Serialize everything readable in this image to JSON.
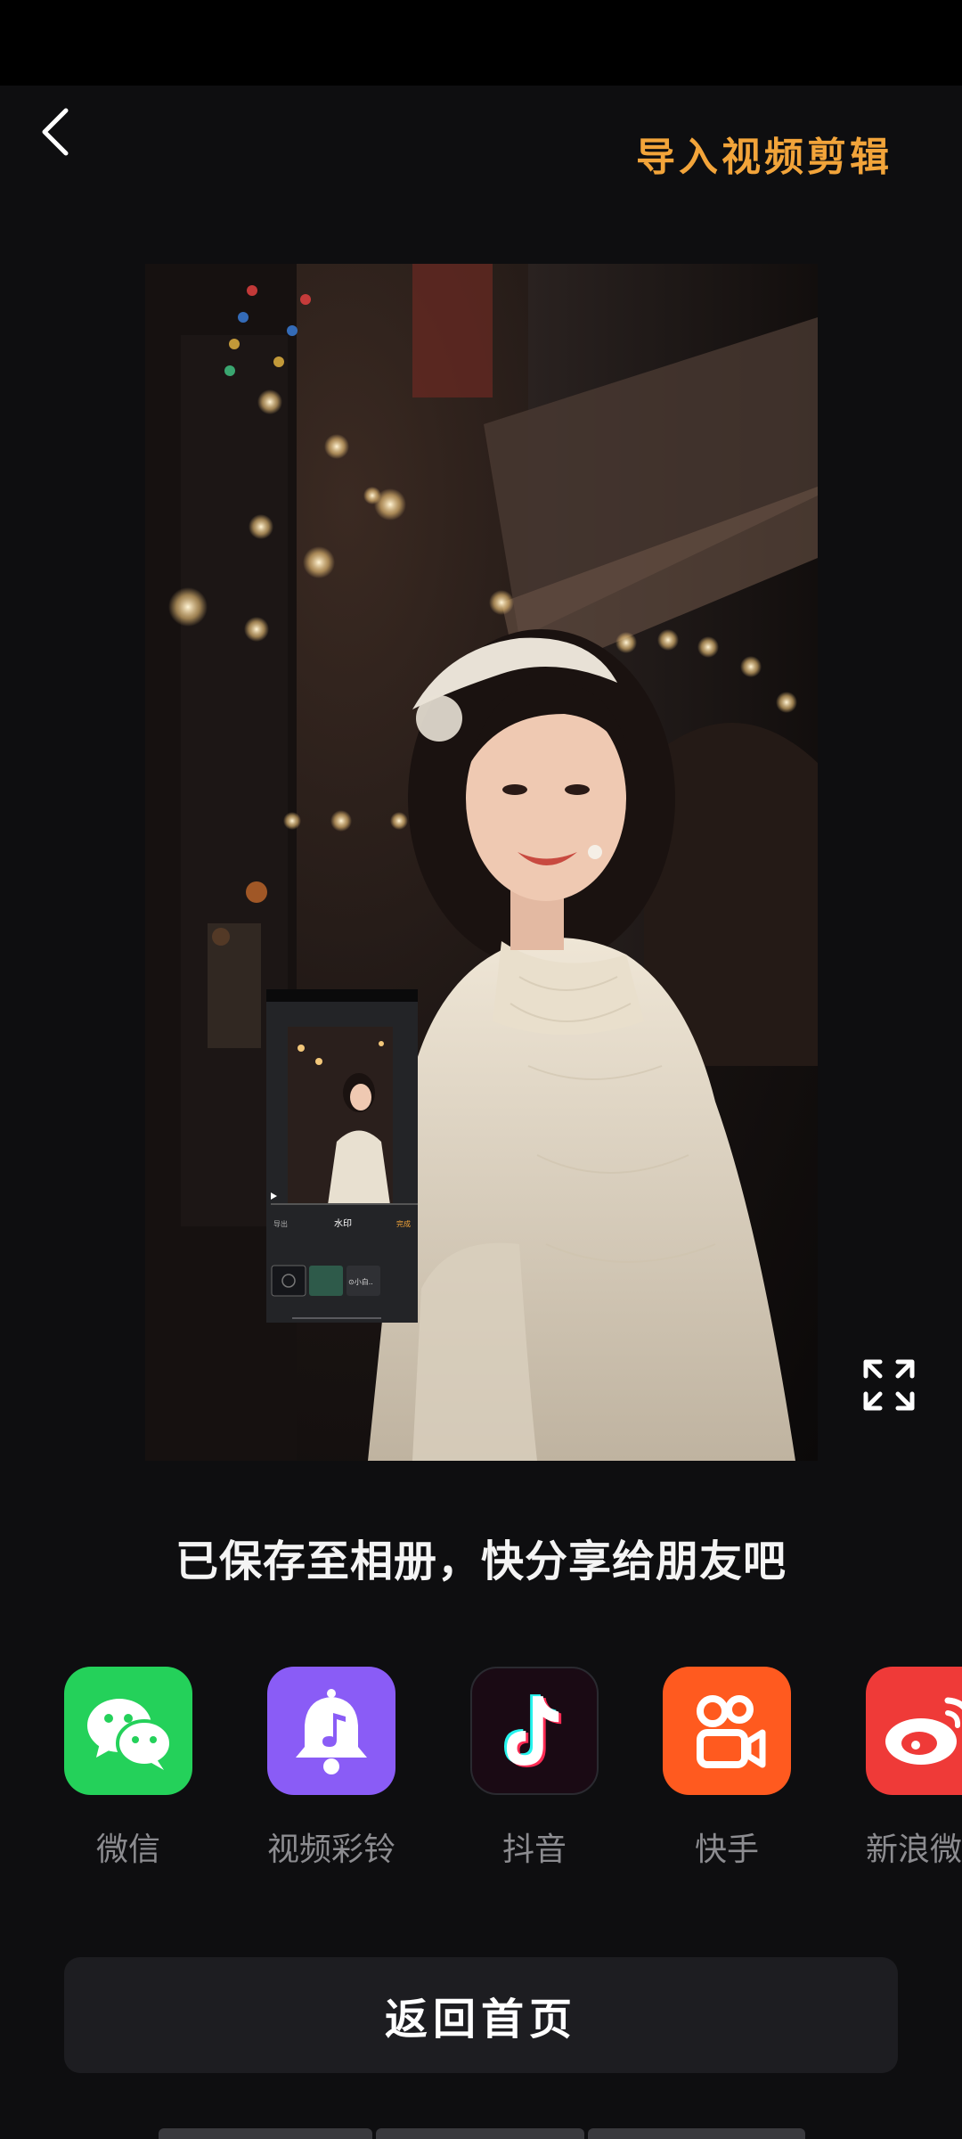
{
  "header": {
    "back_icon": "chevron-left-icon",
    "import_label": "导入视频剪辑",
    "accent_color": "#f2a43a"
  },
  "preview": {
    "content": "photo",
    "fullscreen_icon": "fullscreen-icon",
    "thumbnail": {
      "left_label": "导出",
      "title": "水印",
      "right_label": "完成",
      "chip_label": "⊙小白.."
    }
  },
  "save_message": "已保存至相册，快分享给朋友吧",
  "share": {
    "items": [
      {
        "label": "微信",
        "icon": "wechat-icon",
        "color": "#24d15a"
      },
      {
        "label": "视频彩铃",
        "icon": "ringtone-bell-icon",
        "color": "#8a5cf6"
      },
      {
        "label": "抖音",
        "icon": "douyin-icon",
        "color": "#1a0a14"
      },
      {
        "label": "快手",
        "icon": "kuaishou-icon",
        "color": "#ff5a1f"
      },
      {
        "label": "新浪微博",
        "icon": "weibo-icon",
        "color": "#ef3a38"
      }
    ]
  },
  "home_button": {
    "label": "返回首页"
  }
}
